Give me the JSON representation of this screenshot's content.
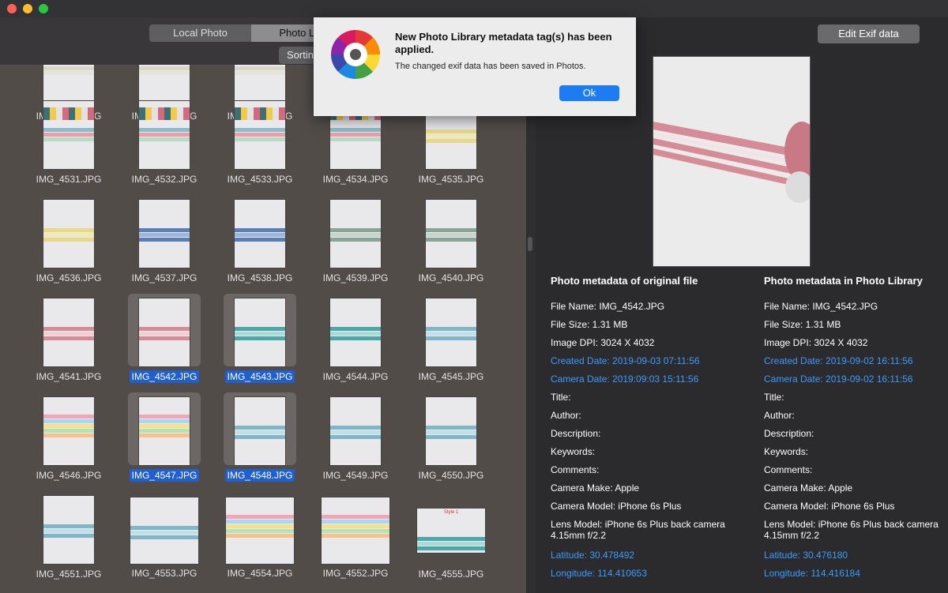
{
  "toolbar": {
    "tab_local": "Local Photo",
    "tab_library": "Photo Libr",
    "sort_label": "Sortin",
    "edit_exif": "Edit Exif data"
  },
  "grid": {
    "items": [
      {
        "name": "IMG_4526.JPG",
        "selected": false,
        "style": "top"
      },
      {
        "name": "IMG_4527.JPG",
        "selected": false,
        "style": "top"
      },
      {
        "name": "IMG_4528.JPG",
        "selected": false,
        "style": "top"
      },
      {
        "name": "",
        "selected": false,
        "style": "none"
      },
      {
        "name": "",
        "selected": false,
        "style": "none"
      },
      {
        "name": "IMG_4531.JPG",
        "selected": false,
        "style": "flags"
      },
      {
        "name": "IMG_4532.JPG",
        "selected": false,
        "style": "flags"
      },
      {
        "name": "IMG_4533.JPG",
        "selected": false,
        "style": "flags"
      },
      {
        "name": "IMG_4534.JPG",
        "selected": false,
        "style": "flags"
      },
      {
        "name": "IMG_4535.JPG",
        "selected": false,
        "style": "yellow"
      },
      {
        "name": "IMG_4536.JPG",
        "selected": false,
        "style": "yellow"
      },
      {
        "name": "IMG_4537.JPG",
        "selected": false,
        "style": "blue"
      },
      {
        "name": "IMG_4538.JPG",
        "selected": false,
        "style": "blue"
      },
      {
        "name": "IMG_4539.JPG",
        "selected": false,
        "style": "green"
      },
      {
        "name": "IMG_4540.JPG",
        "selected": false,
        "style": "green"
      },
      {
        "name": "IMG_4541.JPG",
        "selected": false,
        "style": "pink"
      },
      {
        "name": "IMG_4542.JPG",
        "selected": true,
        "style": "pink"
      },
      {
        "name": "IMG_4543.JPG",
        "selected": true,
        "style": "teal"
      },
      {
        "name": "IMG_4544.JPG",
        "selected": false,
        "style": "teal"
      },
      {
        "name": "IMG_4545.JPG",
        "selected": false,
        "style": "circles"
      },
      {
        "name": "IMG_4546.JPG",
        "selected": false,
        "style": "rainbow"
      },
      {
        "name": "IMG_4547.JPG",
        "selected": true,
        "style": "rainbow"
      },
      {
        "name": "IMG_4548.JPG",
        "selected": true,
        "style": "circles"
      },
      {
        "name": "IMG_4549.JPG",
        "selected": false,
        "style": "circles"
      },
      {
        "name": "IMG_4550.JPG",
        "selected": false,
        "style": "circles"
      },
      {
        "name": "IMG_4551.JPG",
        "selected": false,
        "style": "circles"
      },
      {
        "name": "IMG_4553.JPG",
        "selected": false,
        "style": "circles"
      },
      {
        "name": "IMG_4554.JPG",
        "selected": false,
        "style": "rainbow"
      },
      {
        "name": "IMG_4552.JPG",
        "selected": false,
        "style": "rainbow"
      },
      {
        "name": "IMG_4555.JPG",
        "selected": false,
        "style": "style1"
      }
    ]
  },
  "preview": {
    "style_label": "Style 1"
  },
  "original": {
    "heading": "Photo metadata of original file",
    "file_name": "File Name: IMG_4542.JPG",
    "file_size": "File Size: 1.31 MB",
    "dpi": "Image DPI: 3024 X 4032",
    "created": "Created Date: 2019-09-03 07:11:56",
    "camera_date": "Camera Date: 2019:09:03 15:11:56",
    "title": "Title:",
    "author": "Author:",
    "description": "Description:",
    "keywords": "Keywords:",
    "comments": "Comments:",
    "make": "Camera Make: Apple",
    "model": "Camera Model: iPhone 6s Plus",
    "lens": "Lens Model: iPhone 6s Plus back camera 4.15mm f/2.2",
    "latitude": "Latitude: 30.478492",
    "longitude": "Longitude: 114.410653"
  },
  "library": {
    "heading": "Photo metadata in Photo Library",
    "file_name": "File Name: IMG_4542.JPG",
    "file_size": "File Size: 1.31 MB",
    "dpi": "Image DPI: 3024 X 4032",
    "created": "Created Date: 2019-09-02 16:11:56",
    "camera_date": "Camera Date: 2019-09-02 16:11:56",
    "title": "Title:",
    "author": "Author:",
    "description": "Description:",
    "keywords": "Keywords:",
    "comments": "Comments:",
    "make": "Camera Make: Apple",
    "model": "Camera Model: iPhone 6s Plus",
    "lens": "Lens Model: iPhone 6s Plus back camera 4.15mm f/2.2",
    "latitude": "Latitude: 30.476180",
    "longitude": "Longitude: 114.416184"
  },
  "dialog": {
    "title": "New Photo Library metadata tag(s) has been applied.",
    "message": "The changed exif data has been saved in Photos.",
    "ok": "Ok"
  },
  "colors": {
    "accent": "#1d7cf2",
    "link_blue": "#3b9cff",
    "selection": "#1f5fd0"
  }
}
